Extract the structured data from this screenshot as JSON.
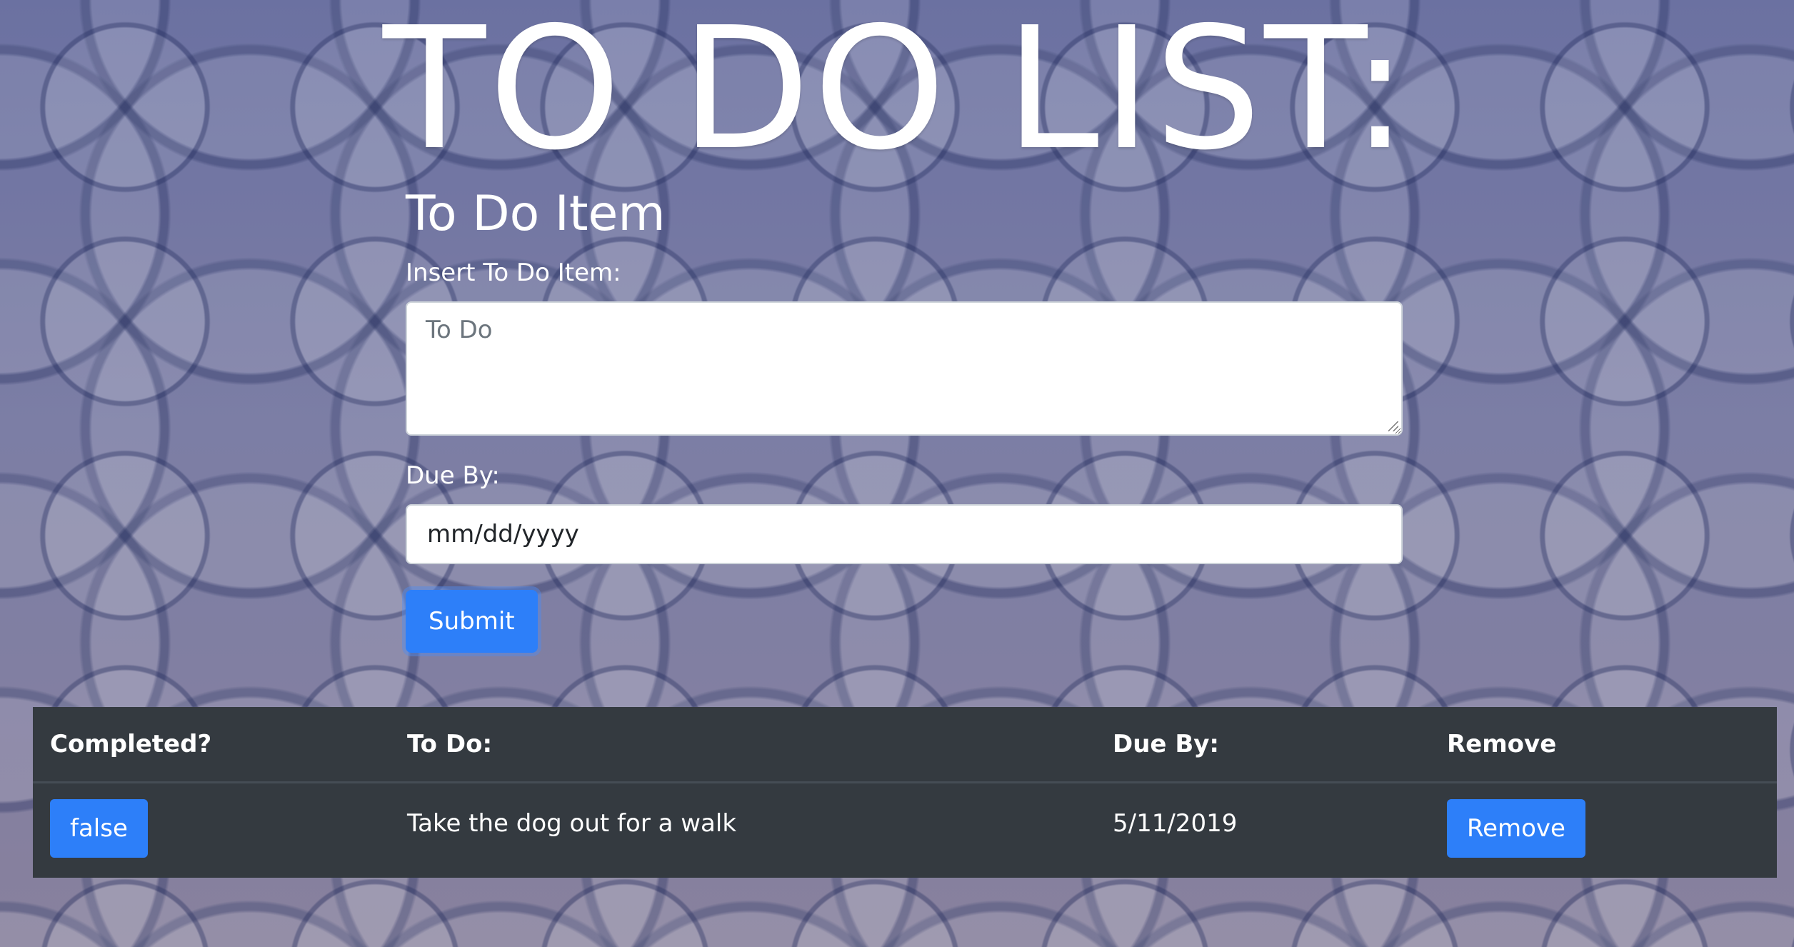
{
  "header": {
    "title": "TO DO LIST:"
  },
  "form": {
    "heading": "To Do Item",
    "item_label": "Insert To Do Item:",
    "item_placeholder": "To Do",
    "due_label": "Due By:",
    "due_placeholder": "mm/dd/yyyy",
    "submit_label": "Submit"
  },
  "table": {
    "headers": [
      "Completed?",
      "To Do:",
      "Due By:",
      "Remove"
    ],
    "rows": [
      {
        "completed": "false",
        "todo": "Take the dog out for a walk",
        "due": "5/11/2019",
        "remove_label": "Remove"
      }
    ]
  },
  "colors": {
    "accent": "#2d7ff9",
    "table_bg": "#343a40"
  }
}
